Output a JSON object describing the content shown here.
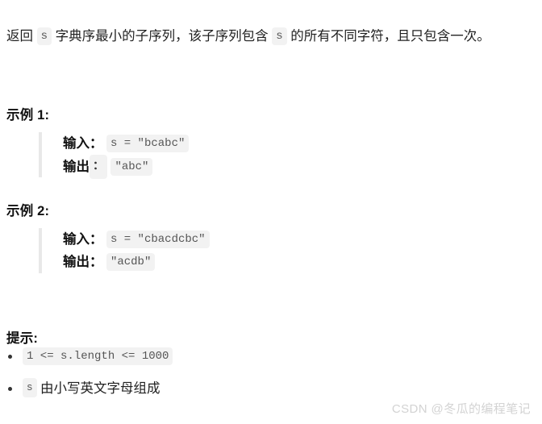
{
  "intro": {
    "part1": "返回",
    "code1": "s",
    "part2": "字典序最小的子序列，该子序列包含",
    "code2": "s",
    "part3": "的所有不同字符，且只包含一次。"
  },
  "examples": [
    {
      "heading": "示例 1:",
      "input_label": "输入",
      "input_colon": "：",
      "input_code": "s = \"bcabc\"",
      "output_label": "输出",
      "output_colon": "：",
      "output_code": "\"abc\""
    },
    {
      "heading": "示例 2:",
      "input_label": "输入",
      "input_colon": "：",
      "input_code": "s = \"cbacdcbc\"",
      "output_label": "输出",
      "output_colon": "：",
      "output_code": "\"acdb\""
    }
  ],
  "hints": {
    "heading": "提示:",
    "items": [
      {
        "code": "1 <= s.length <= 1000",
        "text": ""
      },
      {
        "code": "s",
        "text": "由小写英文字母组成"
      }
    ]
  },
  "watermark": "CSDN @冬瓜的编程笔记",
  "colors": {
    "text": "#1f1f1f",
    "code_bg": "#f2f2f2",
    "code_text": "#555555",
    "quote_border": "#e8e8e8",
    "watermark": "#d3d3d3"
  }
}
